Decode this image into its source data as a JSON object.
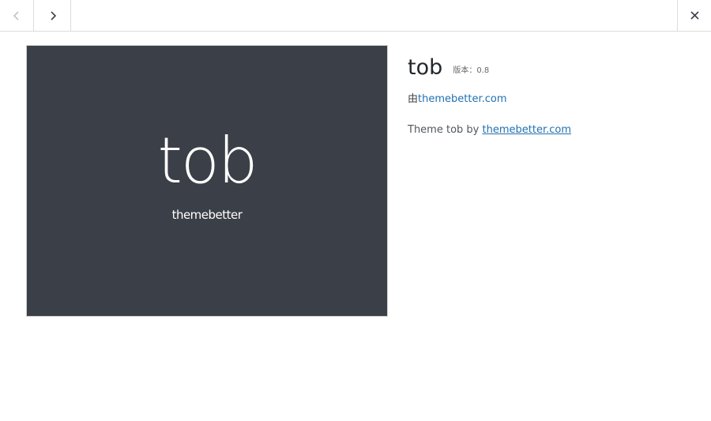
{
  "topbar": {
    "prev_icon": "chevron-left-icon",
    "next_icon": "chevron-right-icon",
    "close_icon": "close-icon"
  },
  "screenshot": {
    "title": "tob",
    "subtitle": "themebetter",
    "background": "#3b3f47"
  },
  "theme": {
    "name": "tob",
    "version_label": "版本：",
    "version": "0.8",
    "author_prefix": "由",
    "author_link": "themebetter.com",
    "description_prefix": "Theme tob by ",
    "description_link": "themebetter.com"
  },
  "colors": {
    "link": "#2271b1",
    "border": "#dcdcde"
  }
}
